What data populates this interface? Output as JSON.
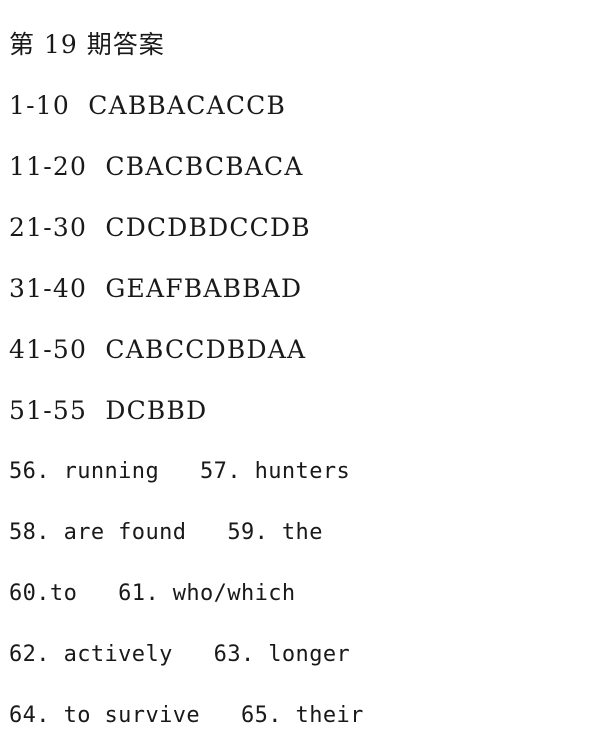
{
  "document": {
    "title": "第 19 期答案",
    "background_color": "#ffffff",
    "text_color": "#191919",
    "lines": [
      {
        "kind": "title",
        "text": "第 19 期答案"
      },
      {
        "kind": "multiple_choice",
        "text": "1-10  CABBACACCB",
        "range": "1-10",
        "answers": "CABBACACCB"
      },
      {
        "kind": "multiple_choice",
        "text": "11-20  CBACBCBACA",
        "range": "11-20",
        "answers": "CBACBCBACA"
      },
      {
        "kind": "multiple_choice",
        "text": "21-30  CDCDBDCCDB",
        "range": "21-30",
        "answers": "CDCDBDCCDB"
      },
      {
        "kind": "multiple_choice",
        "text": "31-40  GEAFBABBAD",
        "range": "31-40",
        "answers": "GEAFBABBAD"
      },
      {
        "kind": "multiple_choice",
        "text": "41-50  CABCCDBDAA",
        "range": "41-50",
        "answers": "CABCCDBDAA"
      },
      {
        "kind": "multiple_choice",
        "text": "51-55  DCBBD",
        "range": "51-55",
        "answers": "DCBBD"
      },
      {
        "kind": "fill_in_blank",
        "text": "56. running   57. hunters"
      },
      {
        "kind": "fill_in_blank",
        "text": "58. are found   59. the"
      },
      {
        "kind": "fill_in_blank",
        "text": "60.to   61. who/which"
      },
      {
        "kind": "fill_in_blank",
        "text": "62. actively   63. longer"
      },
      {
        "kind": "fill_in_blank",
        "text": "64. to survive   65. their"
      }
    ],
    "fill_in_answers": [
      {
        "number": "56.",
        "answer": "running"
      },
      {
        "number": "57.",
        "answer": "hunters"
      },
      {
        "number": "58.",
        "answer": "are found"
      },
      {
        "number": "59.",
        "answer": "the"
      },
      {
        "number": "60.",
        "answer": "to"
      },
      {
        "number": "61.",
        "answer": "who/which"
      },
      {
        "number": "62.",
        "answer": "actively"
      },
      {
        "number": "63.",
        "answer": "longer"
      },
      {
        "number": "64.",
        "answer": "to survive"
      },
      {
        "number": "65.",
        "answer": "their"
      }
    ]
  }
}
